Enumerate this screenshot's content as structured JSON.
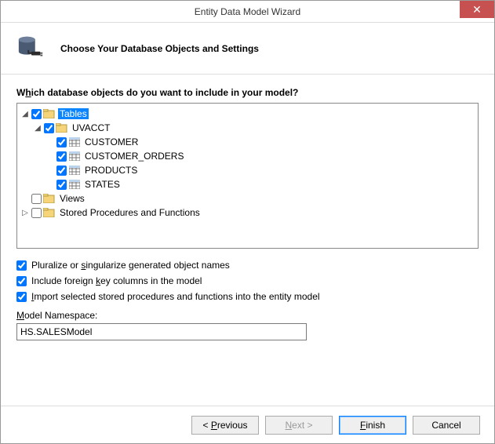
{
  "window": {
    "title": "Entity Data Model Wizard"
  },
  "header": {
    "title": "Choose Your Database Objects and Settings"
  },
  "prompt": {
    "before": "W",
    "u": "h",
    "after": "ich database objects do you want to include in your model?"
  },
  "tree": {
    "tables": {
      "label": "Tables",
      "checked": true
    },
    "schema": {
      "label": "UVACCT",
      "checked": true
    },
    "t1": {
      "label": "CUSTOMER",
      "checked": true
    },
    "t2": {
      "label": "CUSTOMER_ORDERS",
      "checked": true
    },
    "t3": {
      "label": "PRODUCTS",
      "checked": true
    },
    "t4": {
      "label": "STATES",
      "checked": true
    },
    "views": {
      "label": "Views",
      "checked": false
    },
    "sprocs": {
      "label": "Stored Procedures and Functions",
      "checked": false
    }
  },
  "options": {
    "pluralize": {
      "before": "Pluralize or ",
      "u": "s",
      "after": "ingularize generated object names",
      "checked": true
    },
    "fk": {
      "before": "Include foreign ",
      "u": "k",
      "after": "ey columns in the model",
      "checked": true
    },
    "import": {
      "before": "",
      "u": "I",
      "after": "mport selected stored procedures and functions into the entity model",
      "checked": true
    }
  },
  "namespace": {
    "label_before": "",
    "label_u": "M",
    "label_after": "odel Namespace:",
    "value": "HS.SALESModel"
  },
  "buttons": {
    "prev_before": "< ",
    "prev_u": "P",
    "prev_after": "revious",
    "next_before": "",
    "next_u": "N",
    "next_after": "ext >",
    "finish_before": "",
    "finish_u": "F",
    "finish_after": "inish",
    "cancel": "Cancel"
  }
}
